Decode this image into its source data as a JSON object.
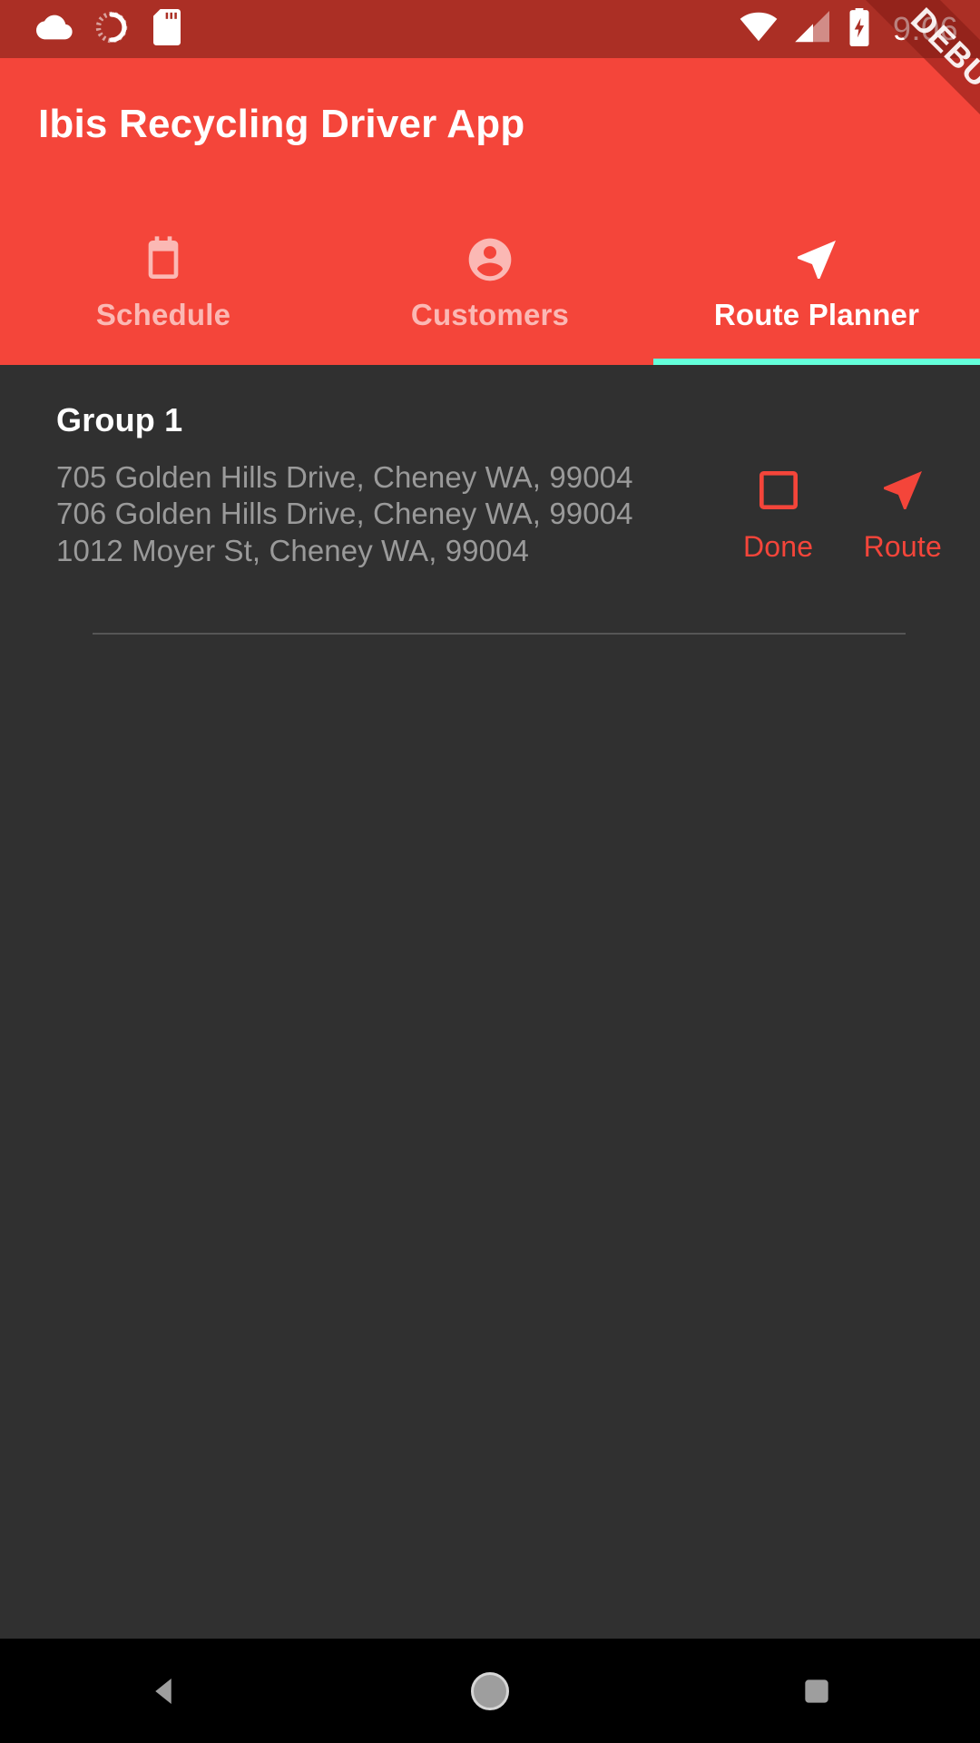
{
  "status_bar": {
    "background": "#AB2F25",
    "time": "9:06",
    "left_icons": [
      "cloud-icon",
      "sync-spinner-icon",
      "sd-card-icon"
    ],
    "right_icons": [
      "wifi-icon",
      "cellular-signal-icon",
      "battery-charging-icon"
    ]
  },
  "debug_ribbon": {
    "label": "DEBUG"
  },
  "app_bar": {
    "background": "#F4453A",
    "title": "Ibis Recycling Driver App",
    "indicator_color": "#64FFDA"
  },
  "tabs": [
    {
      "label": "Schedule",
      "icon": "calendar-icon",
      "active": false
    },
    {
      "label": "Customers",
      "icon": "account-circle-icon",
      "active": false
    },
    {
      "label": "Route Planner",
      "icon": "navigation-arrow-icon",
      "active": true
    }
  ],
  "content": {
    "background": "#303030",
    "groups": [
      {
        "title": "Group 1",
        "addresses": [
          "705 Golden Hills Drive, Cheney WA, 99004",
          "706 Golden Hills Drive, Cheney WA, 99004",
          "1012 Moyer St, Cheney WA, 99004"
        ],
        "actions": [
          {
            "label": "Done",
            "icon": "checkbox-unchecked-icon",
            "color": "#F4453A"
          },
          {
            "label": "Route",
            "icon": "navigation-arrow-icon",
            "color": "#F4453A"
          }
        ]
      }
    ]
  },
  "nav_bar": {
    "background": "#000000",
    "buttons": [
      {
        "name": "back",
        "icon": "back-triangle-icon"
      },
      {
        "name": "home",
        "icon": "home-circle-icon"
      },
      {
        "name": "recents",
        "icon": "recents-square-icon"
      }
    ]
  }
}
